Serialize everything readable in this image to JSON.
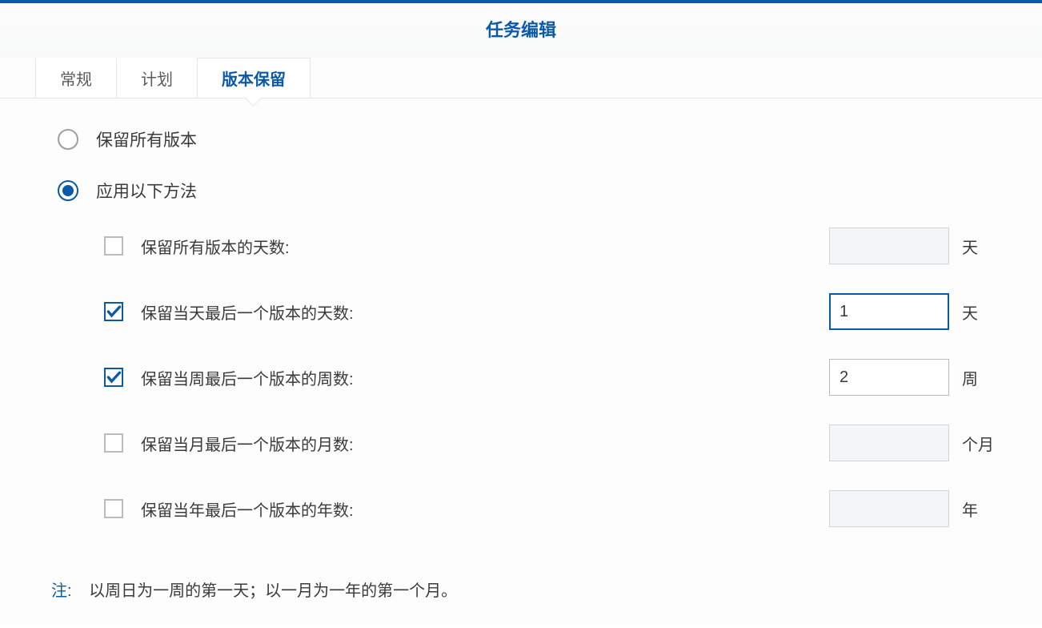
{
  "title": "任务编辑",
  "tabs": [
    {
      "label": "常规",
      "active": false
    },
    {
      "label": "计划",
      "active": false
    },
    {
      "label": "版本保留",
      "active": true
    }
  ],
  "radio": {
    "keep_all": {
      "label": "保留所有版本",
      "selected": false
    },
    "apply_methods": {
      "label": "应用以下方法",
      "selected": true
    }
  },
  "options": {
    "all_versions_days": {
      "label": "保留所有版本的天数:",
      "checked": false,
      "value": "",
      "unit": "天"
    },
    "last_daily_days": {
      "label": "保留当天最后一个版本的天数:",
      "checked": true,
      "value": "1",
      "unit": "天"
    },
    "last_weekly_weeks": {
      "label": "保留当周最后一个版本的周数:",
      "checked": true,
      "value": "2",
      "unit": "周"
    },
    "last_monthly_months": {
      "label": "保留当月最后一个版本的月数:",
      "checked": false,
      "value": "",
      "unit": "个月"
    },
    "last_yearly_years": {
      "label": "保留当年最后一个版本的年数:",
      "checked": false,
      "value": "",
      "unit": "年"
    }
  },
  "note": {
    "label": "注:",
    "text": "以周日为一周的第一天；以一月为一年的第一个月。"
  }
}
